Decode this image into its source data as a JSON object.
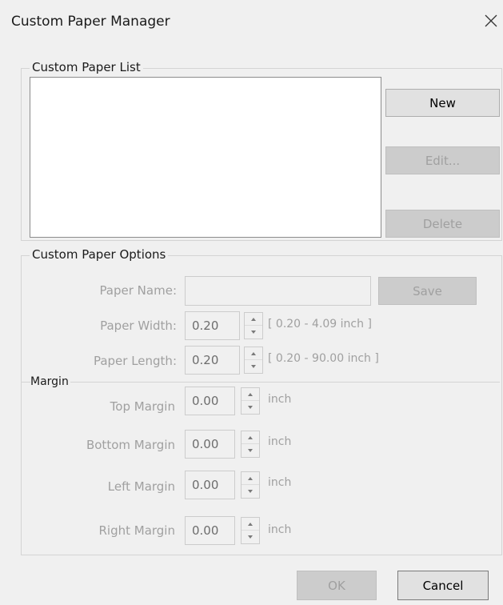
{
  "window": {
    "title": "Custom Paper Manager"
  },
  "list_group": {
    "label": "Custom Paper List",
    "items": []
  },
  "list_buttons": {
    "new": "New",
    "edit": "Edit...",
    "delete": "Delete"
  },
  "options": {
    "label": "Custom Paper Options",
    "paper_name_label": "Paper Name:",
    "paper_name_value": "",
    "save": "Save",
    "width_label": "Paper Width:",
    "width_value": "0.20",
    "width_range": "[ 0.20 - 4.09 inch ]",
    "length_label": "Paper Length:",
    "length_value": "0.20",
    "length_range": "[ 0.20 - 90.00 inch ]"
  },
  "margin": {
    "label": "Margin",
    "unit": "inch",
    "top_label": "Top Margin",
    "top_value": "0.00",
    "bottom_label": "Bottom Margin",
    "bottom_value": "0.00",
    "left_label": "Left Margin",
    "left_value": "0.00",
    "right_label": "Right Margin",
    "right_value": "0.00"
  },
  "footer": {
    "ok": "OK",
    "cancel": "Cancel"
  }
}
